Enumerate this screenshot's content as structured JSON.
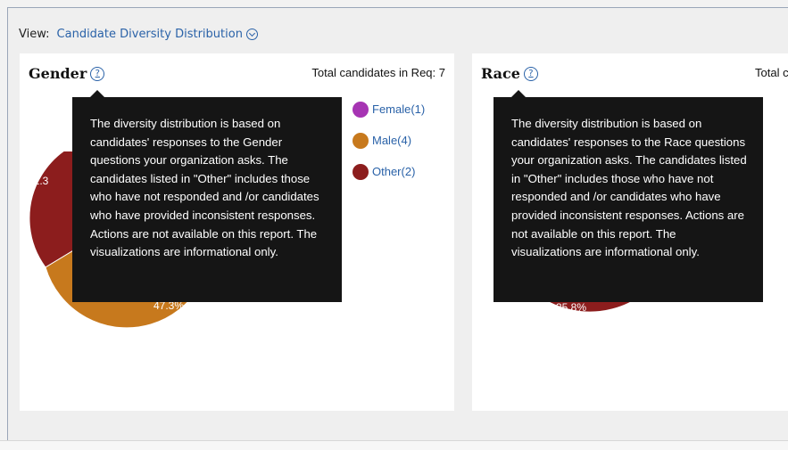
{
  "view": {
    "label": "View:",
    "selected": "Candidate Diversity Distribution",
    "dropdown_icon": "chevron-down-circle-icon"
  },
  "gender_card": {
    "title": "Gender",
    "help_icon_text": "?",
    "total_label": "Total candidates in Req: 7",
    "tooltip": "The diversity distribution is based on candidates' responses to the Gender questions your organization asks. The candidates listed in \"Other\" includes those who have not responded and /or candidates who have provided inconsistent responses. Actions are not available on this report. The visualizations are informational only.",
    "legend": [
      {
        "label": "Female(1)",
        "color": "#a634b3"
      },
      {
        "label": "Male(4)",
        "color": "#c7791d"
      },
      {
        "label": "Other(2)",
        "color": "#8c1d1d"
      }
    ],
    "pct_labels": [
      "32.3",
      "47.3%"
    ]
  },
  "race_card": {
    "title": "Race",
    "help_icon_text": "?",
    "total_label": "Total c",
    "tooltip": "The diversity distribution is based on candidates' responses to the Race questions your organization asks. The candidates listed in \"Other\" includes those who have not responded and /or candidates who have provided inconsistent responses. Actions are not available on this report. The visualizations are informational only.",
    "pct_labels": [
      "35.8%"
    ]
  },
  "colors": {
    "link": "#2a62a8",
    "female": "#a634b3",
    "male": "#c7791d",
    "other": "#8c1d1d",
    "teal": "#2c7a86",
    "tooltip_bg": "#151515"
  }
}
